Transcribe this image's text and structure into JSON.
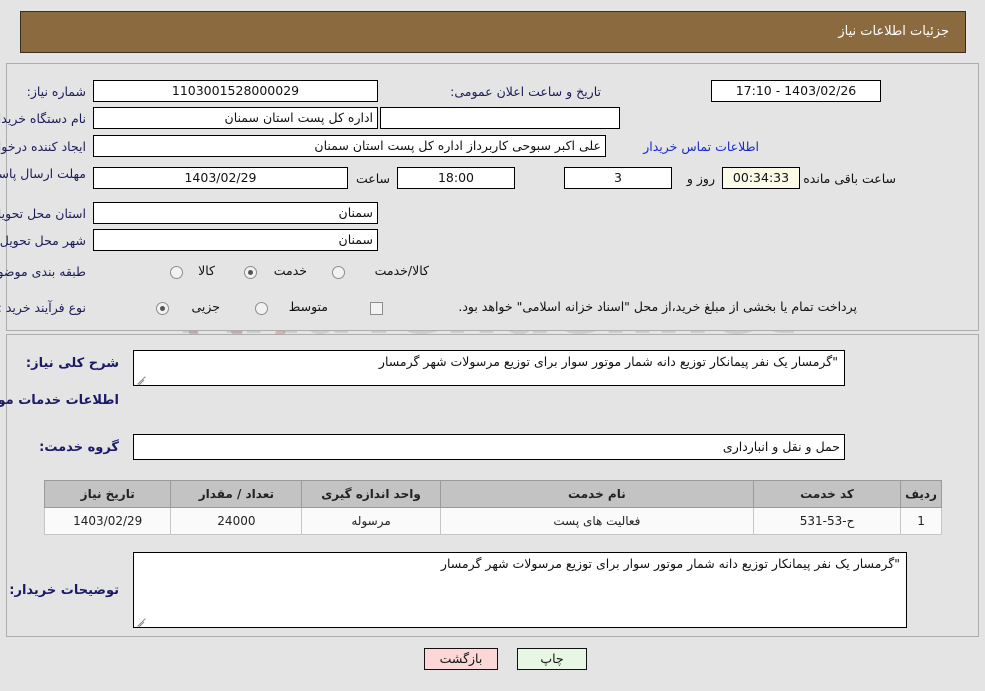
{
  "header": {
    "title": "جزئیات اطلاعات نیاز"
  },
  "form": {
    "need_number_label": "شماره نیاز:",
    "need_number_value": "1103001528000029",
    "announce_label": "تاریخ و ساعت اعلان عمومی:",
    "announce_value": "17:10 - 1403/02/26",
    "buyer_org_label": "نام دستگاه خریدار:",
    "buyer_org_value": "اداره کل پست استان سمنان",
    "buyer_org_extra_value": "",
    "creator_label": "ایجاد کننده درخواست:",
    "creator_value": "علی اکبر سبوحی کاربرداز اداره کل پست استان سمنان",
    "contact_link": "اطلاعات تماس خریدار",
    "deadline_label": "مهلت ارسال پاسخ: تا تاریخ:",
    "deadline_date": "1403/02/29",
    "hour_label": "ساعت",
    "hour_value": "18:00",
    "days_value": "3",
    "days_unit_label": "روز و",
    "countdown_value": "00:34:33",
    "remaining_label": "ساعت باقی مانده",
    "province_label": "استان محل تحویل:",
    "province_value": "سمنان",
    "city_label": "شهر محل تحویل:",
    "city_value": "سمنان",
    "category_label": "طبقه بندی موضوعی:",
    "category_options": [
      {
        "label": "کالا",
        "selected": false
      },
      {
        "label": "خدمت",
        "selected": true
      },
      {
        "label": "کالا/خدمت",
        "selected": false
      }
    ],
    "process_label": "نوع فرآیند خرید :",
    "process_options": [
      {
        "label": "جزیی",
        "selected": true
      },
      {
        "label": "متوسط",
        "selected": false
      }
    ],
    "treasury_checkbox_label": "پرداخت تمام یا بخشی از مبلغ خرید،از محل \"اسناد خزانه اسلامی\" خواهد بود.",
    "treasury_checked": false
  },
  "description": {
    "general_label": "شرح کلی نیاز:",
    "general_value": "\"گرمسار یک نفر پیمانکار توزیع دانه شمار موتور سوار برای توزیع مرسولات شهر گرمسار",
    "services_heading": "اطلاعات خدمات مورد نیاز",
    "service_group_label": "گروه خدمت:",
    "service_group_value": "حمل و نقل و انبارداری"
  },
  "table": {
    "columns": [
      "ردیف",
      "کد خدمت",
      "نام خدمت",
      "واحد اندازه گیری",
      "تعداد / مقدار",
      "تاریخ نیاز"
    ],
    "rows": [
      {
        "row": "1",
        "service_code": "ح-53-531",
        "service_name": "فعالیت های پست",
        "unit": "مرسوله",
        "quantity": "24000",
        "need_date": "1403/02/29"
      }
    ]
  },
  "notes": {
    "label": "توضیحات خریدار:",
    "value": "\"گرمسار یک نفر پیمانکار توزیع دانه شمار موتور سوار برای توزیع مرسولات شهر گرمسار"
  },
  "buttons": {
    "print": "چاپ",
    "back": "بازگشت"
  },
  "watermark": {
    "text": "AriaTender.net"
  }
}
